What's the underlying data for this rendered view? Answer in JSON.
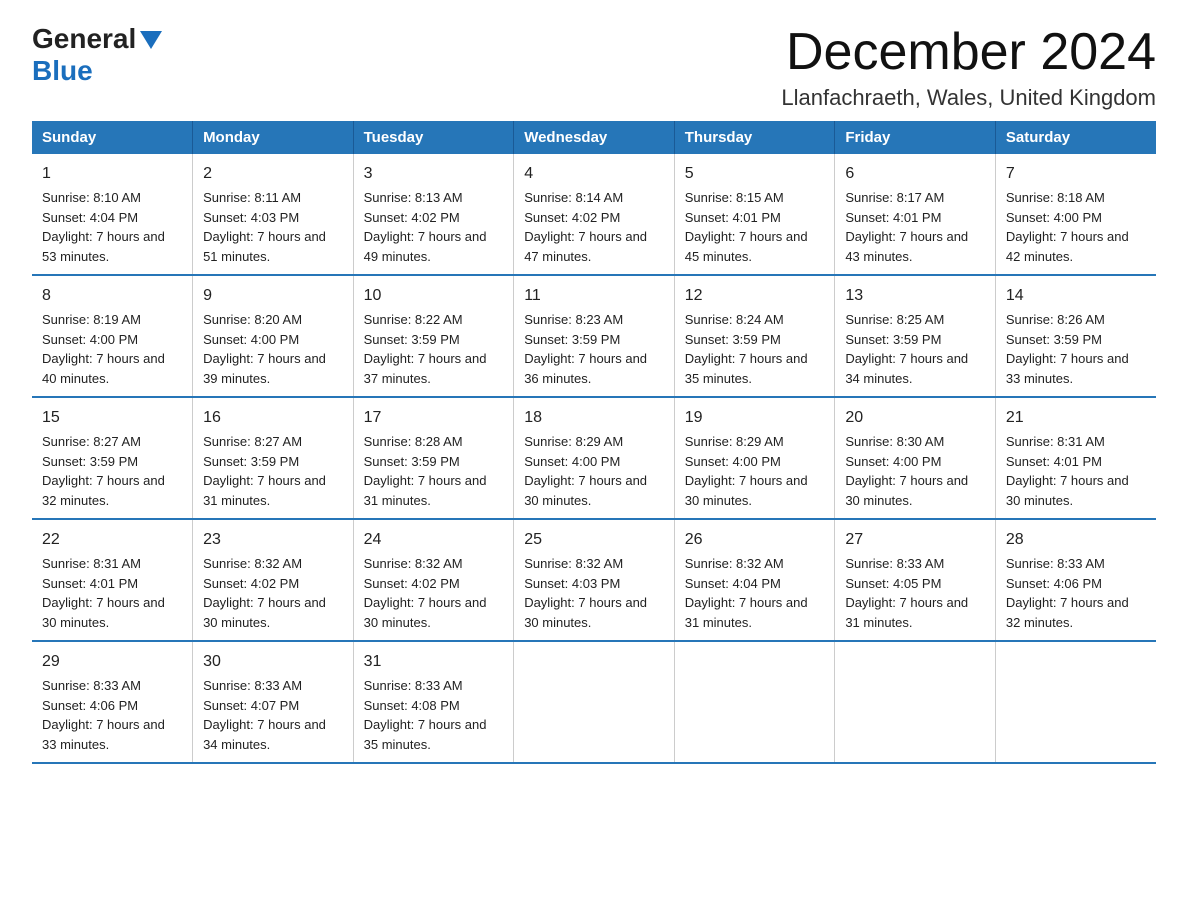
{
  "header": {
    "logo_line1": "General",
    "logo_line2": "Blue",
    "month_title": "December 2024",
    "location": "Llanfachraeth, Wales, United Kingdom"
  },
  "days_of_week": [
    "Sunday",
    "Monday",
    "Tuesday",
    "Wednesday",
    "Thursday",
    "Friday",
    "Saturday"
  ],
  "weeks": [
    [
      {
        "day": "1",
        "sunrise": "Sunrise: 8:10 AM",
        "sunset": "Sunset: 4:04 PM",
        "daylight": "Daylight: 7 hours and 53 minutes."
      },
      {
        "day": "2",
        "sunrise": "Sunrise: 8:11 AM",
        "sunset": "Sunset: 4:03 PM",
        "daylight": "Daylight: 7 hours and 51 minutes."
      },
      {
        "day": "3",
        "sunrise": "Sunrise: 8:13 AM",
        "sunset": "Sunset: 4:02 PM",
        "daylight": "Daylight: 7 hours and 49 minutes."
      },
      {
        "day": "4",
        "sunrise": "Sunrise: 8:14 AM",
        "sunset": "Sunset: 4:02 PM",
        "daylight": "Daylight: 7 hours and 47 minutes."
      },
      {
        "day": "5",
        "sunrise": "Sunrise: 8:15 AM",
        "sunset": "Sunset: 4:01 PM",
        "daylight": "Daylight: 7 hours and 45 minutes."
      },
      {
        "day": "6",
        "sunrise": "Sunrise: 8:17 AM",
        "sunset": "Sunset: 4:01 PM",
        "daylight": "Daylight: 7 hours and 43 minutes."
      },
      {
        "day": "7",
        "sunrise": "Sunrise: 8:18 AM",
        "sunset": "Sunset: 4:00 PM",
        "daylight": "Daylight: 7 hours and 42 minutes."
      }
    ],
    [
      {
        "day": "8",
        "sunrise": "Sunrise: 8:19 AM",
        "sunset": "Sunset: 4:00 PM",
        "daylight": "Daylight: 7 hours and 40 minutes."
      },
      {
        "day": "9",
        "sunrise": "Sunrise: 8:20 AM",
        "sunset": "Sunset: 4:00 PM",
        "daylight": "Daylight: 7 hours and 39 minutes."
      },
      {
        "day": "10",
        "sunrise": "Sunrise: 8:22 AM",
        "sunset": "Sunset: 3:59 PM",
        "daylight": "Daylight: 7 hours and 37 minutes."
      },
      {
        "day": "11",
        "sunrise": "Sunrise: 8:23 AM",
        "sunset": "Sunset: 3:59 PM",
        "daylight": "Daylight: 7 hours and 36 minutes."
      },
      {
        "day": "12",
        "sunrise": "Sunrise: 8:24 AM",
        "sunset": "Sunset: 3:59 PM",
        "daylight": "Daylight: 7 hours and 35 minutes."
      },
      {
        "day": "13",
        "sunrise": "Sunrise: 8:25 AM",
        "sunset": "Sunset: 3:59 PM",
        "daylight": "Daylight: 7 hours and 34 minutes."
      },
      {
        "day": "14",
        "sunrise": "Sunrise: 8:26 AM",
        "sunset": "Sunset: 3:59 PM",
        "daylight": "Daylight: 7 hours and 33 minutes."
      }
    ],
    [
      {
        "day": "15",
        "sunrise": "Sunrise: 8:27 AM",
        "sunset": "Sunset: 3:59 PM",
        "daylight": "Daylight: 7 hours and 32 minutes."
      },
      {
        "day": "16",
        "sunrise": "Sunrise: 8:27 AM",
        "sunset": "Sunset: 3:59 PM",
        "daylight": "Daylight: 7 hours and 31 minutes."
      },
      {
        "day": "17",
        "sunrise": "Sunrise: 8:28 AM",
        "sunset": "Sunset: 3:59 PM",
        "daylight": "Daylight: 7 hours and 31 minutes."
      },
      {
        "day": "18",
        "sunrise": "Sunrise: 8:29 AM",
        "sunset": "Sunset: 4:00 PM",
        "daylight": "Daylight: 7 hours and 30 minutes."
      },
      {
        "day": "19",
        "sunrise": "Sunrise: 8:29 AM",
        "sunset": "Sunset: 4:00 PM",
        "daylight": "Daylight: 7 hours and 30 minutes."
      },
      {
        "day": "20",
        "sunrise": "Sunrise: 8:30 AM",
        "sunset": "Sunset: 4:00 PM",
        "daylight": "Daylight: 7 hours and 30 minutes."
      },
      {
        "day": "21",
        "sunrise": "Sunrise: 8:31 AM",
        "sunset": "Sunset: 4:01 PM",
        "daylight": "Daylight: 7 hours and 30 minutes."
      }
    ],
    [
      {
        "day": "22",
        "sunrise": "Sunrise: 8:31 AM",
        "sunset": "Sunset: 4:01 PM",
        "daylight": "Daylight: 7 hours and 30 minutes."
      },
      {
        "day": "23",
        "sunrise": "Sunrise: 8:32 AM",
        "sunset": "Sunset: 4:02 PM",
        "daylight": "Daylight: 7 hours and 30 minutes."
      },
      {
        "day": "24",
        "sunrise": "Sunrise: 8:32 AM",
        "sunset": "Sunset: 4:02 PM",
        "daylight": "Daylight: 7 hours and 30 minutes."
      },
      {
        "day": "25",
        "sunrise": "Sunrise: 8:32 AM",
        "sunset": "Sunset: 4:03 PM",
        "daylight": "Daylight: 7 hours and 30 minutes."
      },
      {
        "day": "26",
        "sunrise": "Sunrise: 8:32 AM",
        "sunset": "Sunset: 4:04 PM",
        "daylight": "Daylight: 7 hours and 31 minutes."
      },
      {
        "day": "27",
        "sunrise": "Sunrise: 8:33 AM",
        "sunset": "Sunset: 4:05 PM",
        "daylight": "Daylight: 7 hours and 31 minutes."
      },
      {
        "day": "28",
        "sunrise": "Sunrise: 8:33 AM",
        "sunset": "Sunset: 4:06 PM",
        "daylight": "Daylight: 7 hours and 32 minutes."
      }
    ],
    [
      {
        "day": "29",
        "sunrise": "Sunrise: 8:33 AM",
        "sunset": "Sunset: 4:06 PM",
        "daylight": "Daylight: 7 hours and 33 minutes."
      },
      {
        "day": "30",
        "sunrise": "Sunrise: 8:33 AM",
        "sunset": "Sunset: 4:07 PM",
        "daylight": "Daylight: 7 hours and 34 minutes."
      },
      {
        "day": "31",
        "sunrise": "Sunrise: 8:33 AM",
        "sunset": "Sunset: 4:08 PM",
        "daylight": "Daylight: 7 hours and 35 minutes."
      },
      {
        "day": "",
        "sunrise": "",
        "sunset": "",
        "daylight": ""
      },
      {
        "day": "",
        "sunrise": "",
        "sunset": "",
        "daylight": ""
      },
      {
        "day": "",
        "sunrise": "",
        "sunset": "",
        "daylight": ""
      },
      {
        "day": "",
        "sunrise": "",
        "sunset": "",
        "daylight": ""
      }
    ]
  ]
}
